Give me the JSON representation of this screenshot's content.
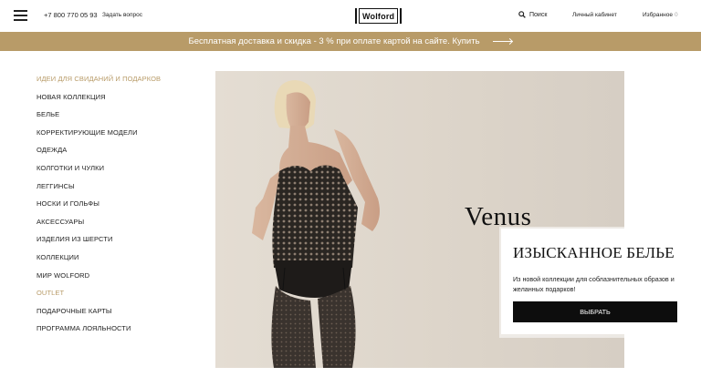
{
  "header": {
    "menu_icon": "hamburger-menu-icon",
    "phone": "+7 800 770 05 93",
    "ask_question": "Задать вопрос",
    "logo_text": "Wolford",
    "search_icon": "search-icon",
    "search_label": "Поиск",
    "account_label": "Личный кабинет",
    "favorites_label": "Избранное",
    "favorites_count": "0"
  },
  "promo": {
    "text": "Бесплатная доставка и скидка - 3 % при оплате картой на сайте. Купить",
    "arrow_icon": "arrow-right-icon",
    "background": "#b89b68"
  },
  "sidebar": {
    "items": [
      {
        "label": "ИДЕИ ДЛЯ СВИДАНИЙ И ПОДАРКОВ",
        "accent": true
      },
      {
        "label": "НОВАЯ КОЛЛЕКЦИЯ"
      },
      {
        "label": "БЕЛЬЕ"
      },
      {
        "label": "КОРРЕКТИРУЮЩИЕ МОДЕЛИ"
      },
      {
        "label": "ОДЕЖДА"
      },
      {
        "label": "КОЛГОТКИ И ЧУЛКИ"
      },
      {
        "label": "ЛЕГГИНСЫ"
      },
      {
        "label": "НОСКИ И ГОЛЬФЫ"
      },
      {
        "label": "АКСЕССУАРЫ"
      },
      {
        "label": "ИЗДЕЛИЯ ИЗ ШЕРСТИ"
      },
      {
        "label": "КОЛЛЕКЦИИ"
      },
      {
        "label": "МИР WOLFORD"
      },
      {
        "label": "OUTLET",
        "accent": true
      },
      {
        "label": "ПОДАРОЧНЫЕ КАРТЫ"
      },
      {
        "label": "ПРОГРАММА ЛОЯЛЬНОСТИ"
      }
    ]
  },
  "hero": {
    "collection_name": "Venus",
    "card_title": "ИЗЫСКАННОЕ БЕЛЬЕ",
    "card_text": "Из новой коллекции для соблазнительных образов и желанных подарков!",
    "card_button": "ВЫБРАТЬ"
  },
  "colors": {
    "accent": "#b89b68",
    "button": "#0d0d0d"
  }
}
